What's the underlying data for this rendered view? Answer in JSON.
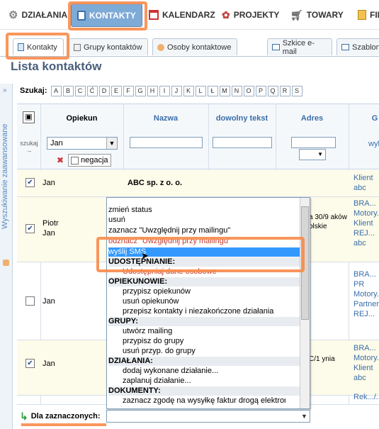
{
  "topnav": {
    "items": [
      {
        "label": "DZIAŁANIA",
        "icon": "gear-icon"
      },
      {
        "label": "KONTAKTY",
        "icon": "contacts-icon"
      },
      {
        "label": "KALENDARZ",
        "icon": "calendar-icon"
      },
      {
        "label": "PROJEKTY",
        "icon": "projects-icon"
      },
      {
        "label": "TOWARY",
        "icon": "cart-icon"
      },
      {
        "label": "FIN",
        "icon": "finance-icon"
      }
    ]
  },
  "subtabs": {
    "items": [
      {
        "label": "Kontakty"
      },
      {
        "label": "Grupy kontaktów"
      },
      {
        "label": "Osoby kontaktowe"
      },
      {
        "label": "Szkice e-mail"
      },
      {
        "label": "Szablon"
      }
    ]
  },
  "page": {
    "title": "Lista kontaktów"
  },
  "sidebar": {
    "label": "Wyszukiwanie zaawansowane"
  },
  "search": {
    "label": "Szukaj:",
    "letters": [
      "A",
      "B",
      "C",
      "Ć",
      "D",
      "E",
      "F",
      "G",
      "H",
      "I",
      "J",
      "K",
      "L",
      "Ł",
      "M",
      "N",
      "O",
      "P",
      "Q",
      "R",
      "S"
    ]
  },
  "table": {
    "headers": {
      "opiekun": "Opiekun",
      "nazwa": "Nazwa",
      "dowolny": "dowolny tekst",
      "adres": "Adres",
      "grupa": "G",
      "szukaj": "szukaj →"
    },
    "filter": {
      "opiekun_value": "Jan",
      "negacja": "negacja",
      "extra": "wyb"
    },
    "rows": [
      {
        "opiekun": "Jan",
        "nazwa": "ABC sp. z o. o.",
        "adres": "",
        "grupy": "Klient abc",
        "checked": true
      },
      {
        "opiekun": "Piotr Jan",
        "nazwa": "",
        "adres": "a 30/9 aków olskie",
        "grupy": "BRA... Motory... Klient REJ... abc",
        "checked": true
      },
      {
        "opiekun": "Jan",
        "nazwa": "",
        "adres": "",
        "grupy": "BRA... PR Motory... Partner REJ...",
        "checked": false
      },
      {
        "opiekun": "Jan",
        "nazwa": "",
        "adres": "C/1 ynia",
        "grupy": "BRA... Motory... Klient abc",
        "checked": true
      },
      {
        "opiekun": "",
        "nazwa": "",
        "adres": "",
        "grupy": "Rek.../...",
        "checked": false
      }
    ]
  },
  "menu": {
    "items": [
      {
        "label": "zmień status",
        "type": "item"
      },
      {
        "label": "usuń",
        "type": "item"
      },
      {
        "label": "zaznacz \"Uwzględnij przy mailingu\"",
        "type": "item"
      },
      {
        "label": "odznacz \"Uwzględnij przy mailingu\"",
        "type": "item"
      },
      {
        "label": "wyślij SMS",
        "type": "selected"
      },
      {
        "label": "UDOSTĘPNIANIE:",
        "type": "group"
      },
      {
        "label": "Udostępniaj dane osobowe",
        "type": "sub"
      },
      {
        "label": "OPIEKUNOWIE:",
        "type": "group"
      },
      {
        "label": "przypisz opiekunów",
        "type": "sub"
      },
      {
        "label": "usuń opiekunów",
        "type": "sub"
      },
      {
        "label": "przepisz kontakty i niezakończone działania",
        "type": "sub"
      },
      {
        "label": "GRUPY:",
        "type": "group"
      },
      {
        "label": "utwórz mailing",
        "type": "sub"
      },
      {
        "label": "przypisz do grupy",
        "type": "sub"
      },
      {
        "label": "usuń przyp. do grupy",
        "type": "sub"
      },
      {
        "label": "DZIAŁANIA:",
        "type": "group"
      },
      {
        "label": "dodaj wykonane działanie...",
        "type": "sub"
      },
      {
        "label": "zaplanuj działanie...",
        "type": "sub"
      },
      {
        "label": "DOKUMENTY:",
        "type": "group"
      },
      {
        "label": "zaznacz zgodę na wysyłkę faktur drogą elektroniczną",
        "type": "sub"
      }
    ]
  },
  "bottom": {
    "label": "Dla zaznaczonych:"
  },
  "colors": {
    "accent": "#f88b4a",
    "brand": "#7eaad6",
    "link": "#3a6ea8"
  }
}
